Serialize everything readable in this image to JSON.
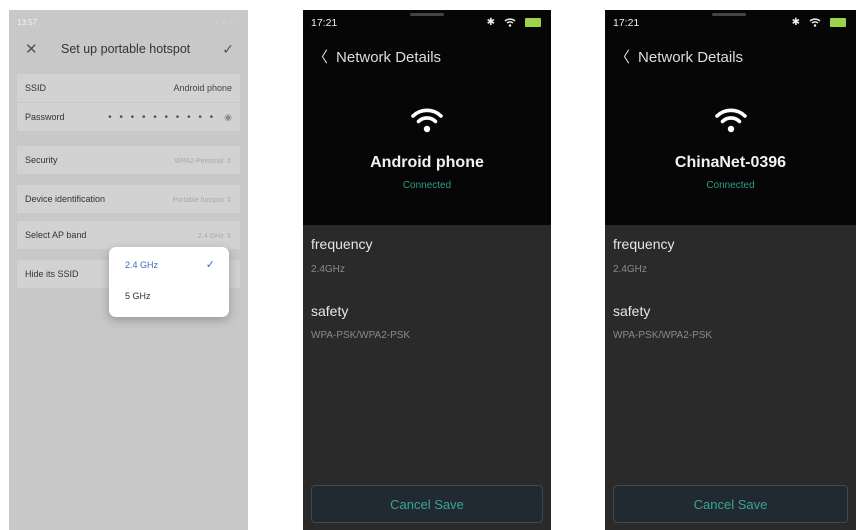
{
  "hotspot": {
    "status_time": "13:57",
    "status_right": "· · · ·",
    "title": "Set up portable hotspot",
    "rows": {
      "ssid_label": "SSID",
      "ssid_value": "Android phone",
      "password_label": "Password",
      "password_value": "• • • • • • • • • •",
      "security_label": "Security",
      "security_value": "WPA2-Personal",
      "device_label": "Device identification",
      "device_value": "Portable hotspot",
      "band_label": "Select AP band",
      "band_value": "2.4 GHz",
      "hide_label": "Hide its SSID"
    },
    "dropdown": {
      "options": [
        "2.4 GHz",
        "5 GHz"
      ],
      "selected": "2.4 GHz"
    }
  },
  "details_android": {
    "time": "17:21",
    "back_label": "Network Details",
    "network_name": "Android phone",
    "status": "Connected",
    "frequency_label": "frequency",
    "frequency_value": "2.4GHz",
    "safety_label": "safety",
    "safety_value": "WPA-PSK/WPA2-PSK",
    "cancel_label": "Cancel Save"
  },
  "details_chinanet": {
    "time": "17:21",
    "back_label": "Network Details",
    "network_name": "ChinaNet-0396",
    "status": "Connected",
    "frequency_label": "frequency",
    "frequency_value": "2.4GHz",
    "safety_label": "safety",
    "safety_value": "WPA-PSK/WPA2-PSK",
    "cancel_label": "Cancel Save"
  },
  "colors": {
    "accent_blue": "#3a6fb8",
    "connected_teal": "#2f9a86",
    "battery_green": "#9bd44a"
  },
  "icons": [
    "close-icon",
    "check-icon",
    "eye-icon",
    "stepper-icon",
    "bluetooth-icon",
    "wifi-icon",
    "battery-icon",
    "back-chevron-icon"
  ]
}
